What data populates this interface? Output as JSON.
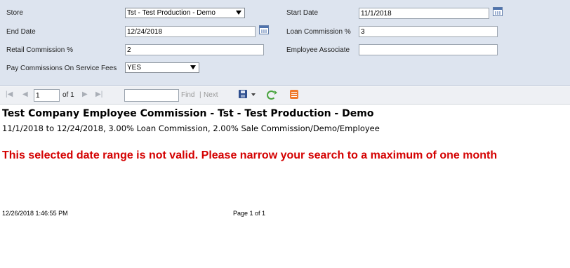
{
  "params": {
    "store": {
      "label": "Store",
      "value": "Tst - Test Production - Demo"
    },
    "start_date": {
      "label": "Start Date",
      "value": "11/1/2018"
    },
    "end_date": {
      "label": "End Date",
      "value": "12/24/2018"
    },
    "loan_commission": {
      "label": "Loan Commission %",
      "value": "3"
    },
    "retail_commission": {
      "label": "Retail Commission %",
      "value": "2"
    },
    "employee_associate": {
      "label": "Employee Associate",
      "value": ""
    },
    "pay_commissions_service_fees": {
      "label": "Pay Commissions On Service Fees",
      "value": "YES"
    }
  },
  "toolbar": {
    "page_value": "1",
    "of_pages": "of 1",
    "find_value": "",
    "find_label": "Find",
    "separator": "|",
    "next_label": "Next",
    "icons": [
      "first-page-icon",
      "prev-page-icon",
      "next-page-icon",
      "last-page-icon",
      "save-icon",
      "refresh-icon",
      "export-icon"
    ]
  },
  "report": {
    "title": "Test Company Employee Commission - Tst - Test Production - Demo",
    "subtitle": "11/1/2018 to 12/24/2018, 3.00% Loan Commission, 2.00% Sale Commission/Demo/Employee",
    "error": "This selected date range is not valid.  Please narrow your search to a maximum of one month",
    "timestamp": "12/26/2018 1:46:55 PM",
    "page_info": "Page 1 of 1"
  },
  "colors": {
    "panel_bg": "#dde4ef",
    "error_red": "#d40000",
    "toolbar_bg": "#eef0f4"
  }
}
